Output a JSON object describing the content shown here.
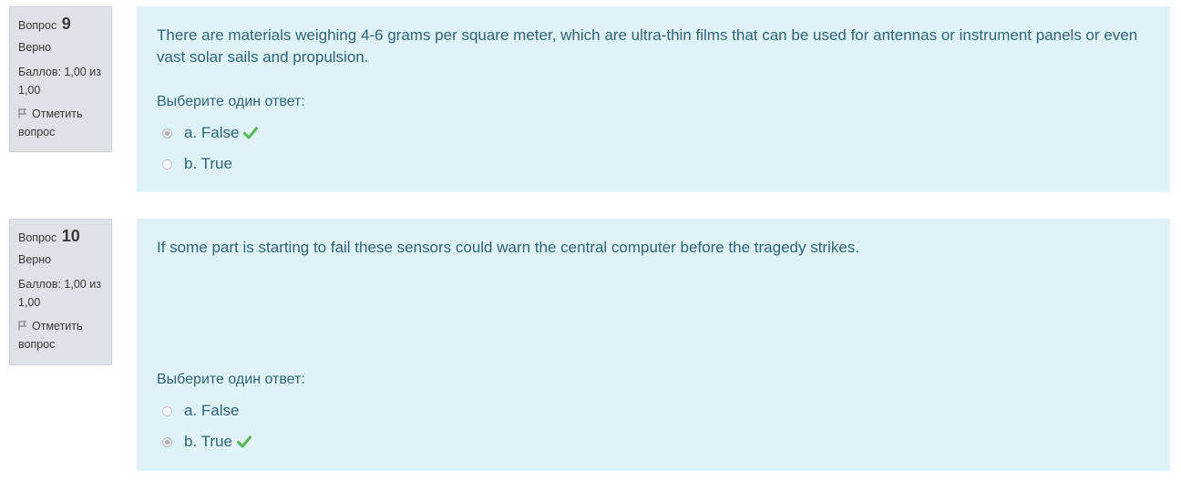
{
  "questions": [
    {
      "label": "Вопрос",
      "number": "9",
      "state": "Верно",
      "grade": "Баллов: 1,00 из 1,00",
      "flag_label": "Отметить вопрос",
      "text": "There are materials weighing 4-6 grams per square meter, which are ultra-thin films that can be used for antennas or instrument panels or even vast solar sails and propulsion.",
      "prompt": "Выберите один ответ:",
      "options": [
        {
          "label": "a. False",
          "selected": true,
          "correct": true
        },
        {
          "label": "b. True",
          "selected": false,
          "correct": false
        }
      ]
    },
    {
      "label": "Вопрос",
      "number": "10",
      "state": "Верно",
      "grade": "Баллов: 1,00 из 1,00",
      "flag_label": "Отметить вопрос",
      "text": "If some part is starting to fail these sensors could warn the central computer before the tragedy strikes.",
      "prompt": "Выберите один ответ:",
      "options": [
        {
          "label": "a. False",
          "selected": false,
          "correct": false
        },
        {
          "label": "b. True",
          "selected": true,
          "correct": true
        }
      ]
    }
  ],
  "icons": {
    "flag": "flag-outline-icon",
    "correct": "check-mark-icon"
  },
  "colors": {
    "info_bg": "#dee2e6",
    "content_bg": "#def2f8",
    "text": "#2f6473",
    "correct": "#5cb85c"
  }
}
